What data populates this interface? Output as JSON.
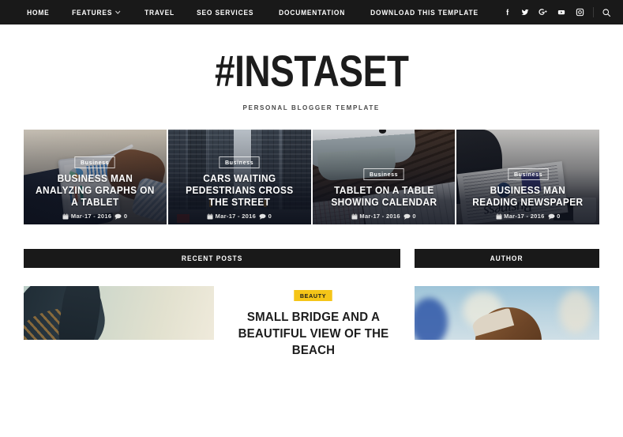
{
  "navbar": {
    "menu": [
      {
        "label": "Home",
        "has_dropdown": false
      },
      {
        "label": "Features",
        "has_dropdown": true
      },
      {
        "label": "Travel",
        "has_dropdown": false
      },
      {
        "label": "SEO Services",
        "has_dropdown": false
      },
      {
        "label": "Documentation",
        "has_dropdown": false
      },
      {
        "label": "Download This Template",
        "has_dropdown": false
      }
    ],
    "social": [
      {
        "name": "facebook-icon"
      },
      {
        "name": "twitter-icon"
      },
      {
        "name": "google-plus-icon"
      },
      {
        "name": "youtube-icon"
      },
      {
        "name": "instagram-icon"
      }
    ],
    "search": {
      "name": "search-icon"
    },
    "background_color": "#191919"
  },
  "header": {
    "logo": "#INSTASET",
    "tagline": "PERSONAL BLOGGER TEMPLATE"
  },
  "featured": [
    {
      "category": "Business",
      "title": "BUSINESS MAN ANALYZING GRAPHS ON A TABLET",
      "date": "Mar-17 - 2016",
      "comments": "0",
      "art": "a1"
    },
    {
      "category": "Business",
      "title": "CARS WAITING PEDESTRIANS CROSS THE STREET",
      "date": "Mar-17 - 2016",
      "comments": "0",
      "art": "a2"
    },
    {
      "category": "Business",
      "title": "TABLET ON A TABLE SHOWING CALENDAR",
      "date": "Mar-17 - 2016",
      "comments": "0",
      "art": "a3"
    },
    {
      "category": "Business",
      "title": "BUSINESS MAN READING NEWSPAPER",
      "date": "Mar-17 - 2016",
      "comments": "0",
      "art": "a4"
    }
  ],
  "sections": {
    "recent_posts_title": "RECENT POSTS",
    "author_title": "AUTHOR"
  },
  "recent_post": {
    "tag": "BEAUTY",
    "tag_color": "#f5c518",
    "title": "SMALL BRIDGE AND A BEAUTIFUL VIEW OF THE BEACH"
  }
}
